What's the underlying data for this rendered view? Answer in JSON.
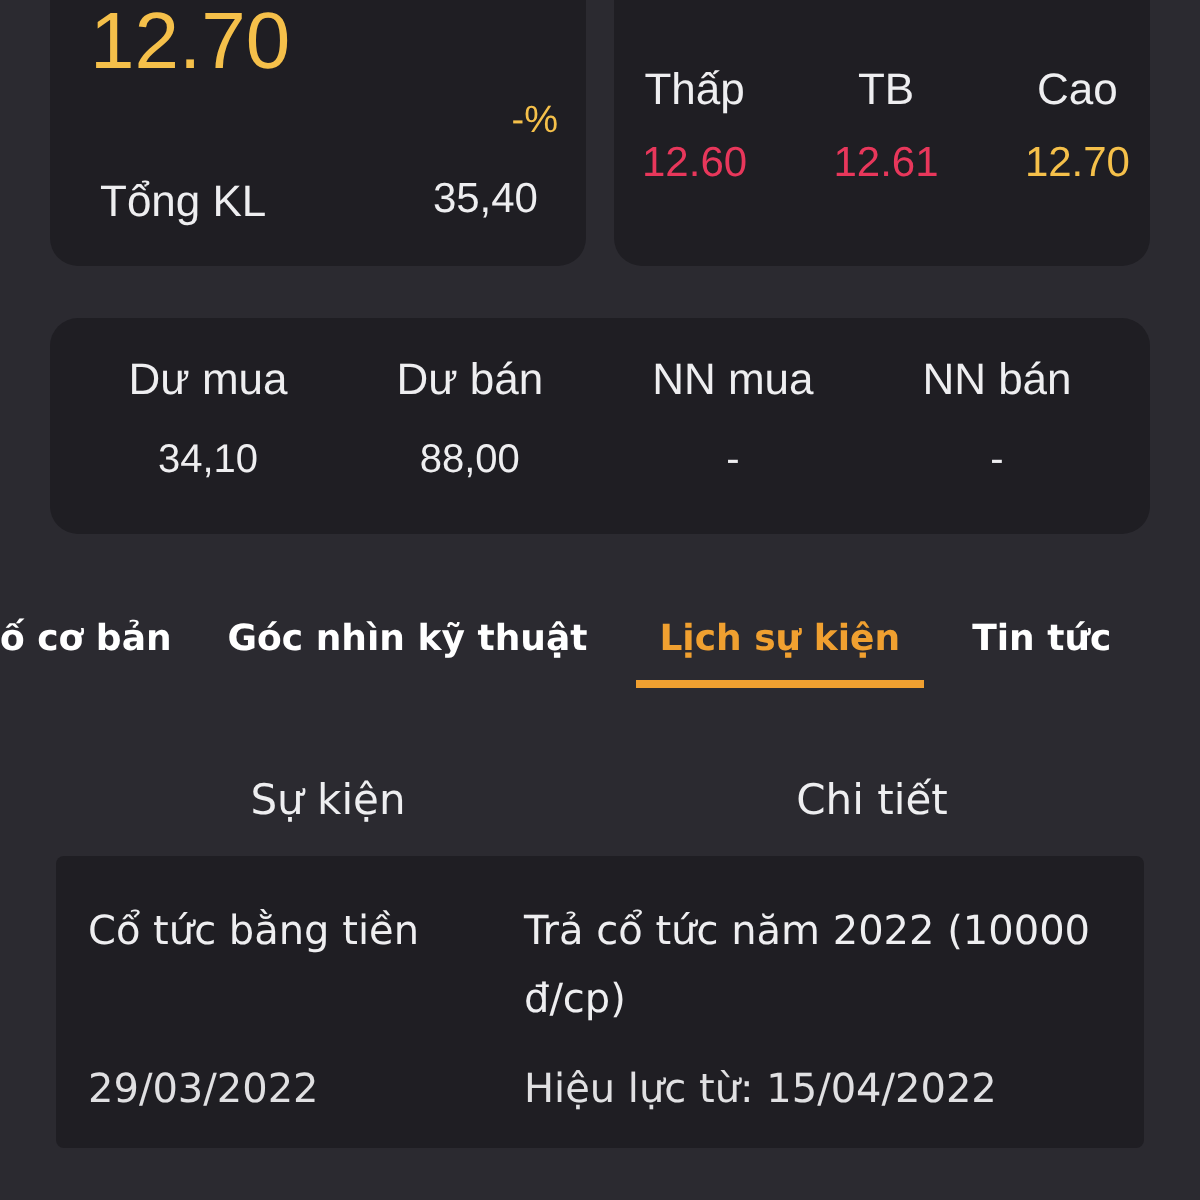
{
  "price_card": {
    "price": "12.70",
    "change": "-%",
    "volume_label": "Tổng KL",
    "volume": "35,40"
  },
  "range_card": {
    "items": [
      {
        "label": "Thấp",
        "value": "12.60",
        "color": "#e8375b"
      },
      {
        "label": "TB",
        "value": "12.61",
        "color": "#e8375b"
      },
      {
        "label": "Cao",
        "value": "12.70",
        "color": "#f5c04a"
      }
    ]
  },
  "orders_card": {
    "items": [
      {
        "label": "Dư mua",
        "value": "34,10"
      },
      {
        "label": "Dư bán",
        "value": "88,00"
      },
      {
        "label": "NN mua",
        "value": "-"
      },
      {
        "label": "NN bán",
        "value": "-"
      }
    ]
  },
  "tabs": [
    {
      "label": "ố cơ bản",
      "selected": false
    },
    {
      "label": "Góc nhìn kỹ thuật",
      "selected": false
    },
    {
      "label": "Lịch sự kiện",
      "selected": true
    },
    {
      "label": "Tin tức",
      "selected": false
    }
  ],
  "events": {
    "columns": [
      "Sự kiện",
      "Chi tiết"
    ],
    "rows": [
      {
        "event": "Cổ tức bằng tiền",
        "detail": "Trả cổ tức năm 2022 (10000 đ/cp)",
        "date": "29/03/2022",
        "effective": "Hiệu lực từ: 15/04/2022"
      }
    ]
  }
}
